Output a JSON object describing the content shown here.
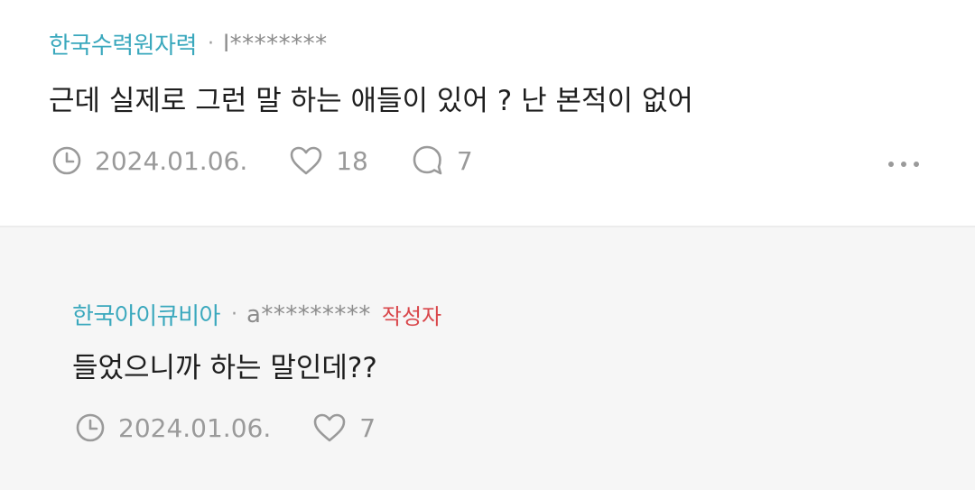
{
  "comments": [
    {
      "company": "한국수력원자력",
      "separator": "·",
      "user": "l********",
      "text": "근데 실제로 그런 말 하는 애들이 있어 ? 난 본적이 없어",
      "date": "2024.01.06.",
      "likes": "18",
      "replies": "7",
      "icons": [
        "clock-icon",
        "heart-icon",
        "speech-bubble-icon",
        "more-icon"
      ]
    },
    {
      "company": "한국아이큐비아",
      "separator": "·",
      "user": "a*********",
      "author_badge": "작성자",
      "text": "들었으니까 하는 말인데??",
      "date": "2024.01.06.",
      "likes": "7",
      "icons": [
        "clock-icon",
        "heart-icon"
      ]
    }
  ],
  "colors": {
    "company": "#3aa8bd",
    "author_badge": "#d9474b",
    "muted": "#9a9a9a",
    "reply_background": "#f6f6f6"
  }
}
